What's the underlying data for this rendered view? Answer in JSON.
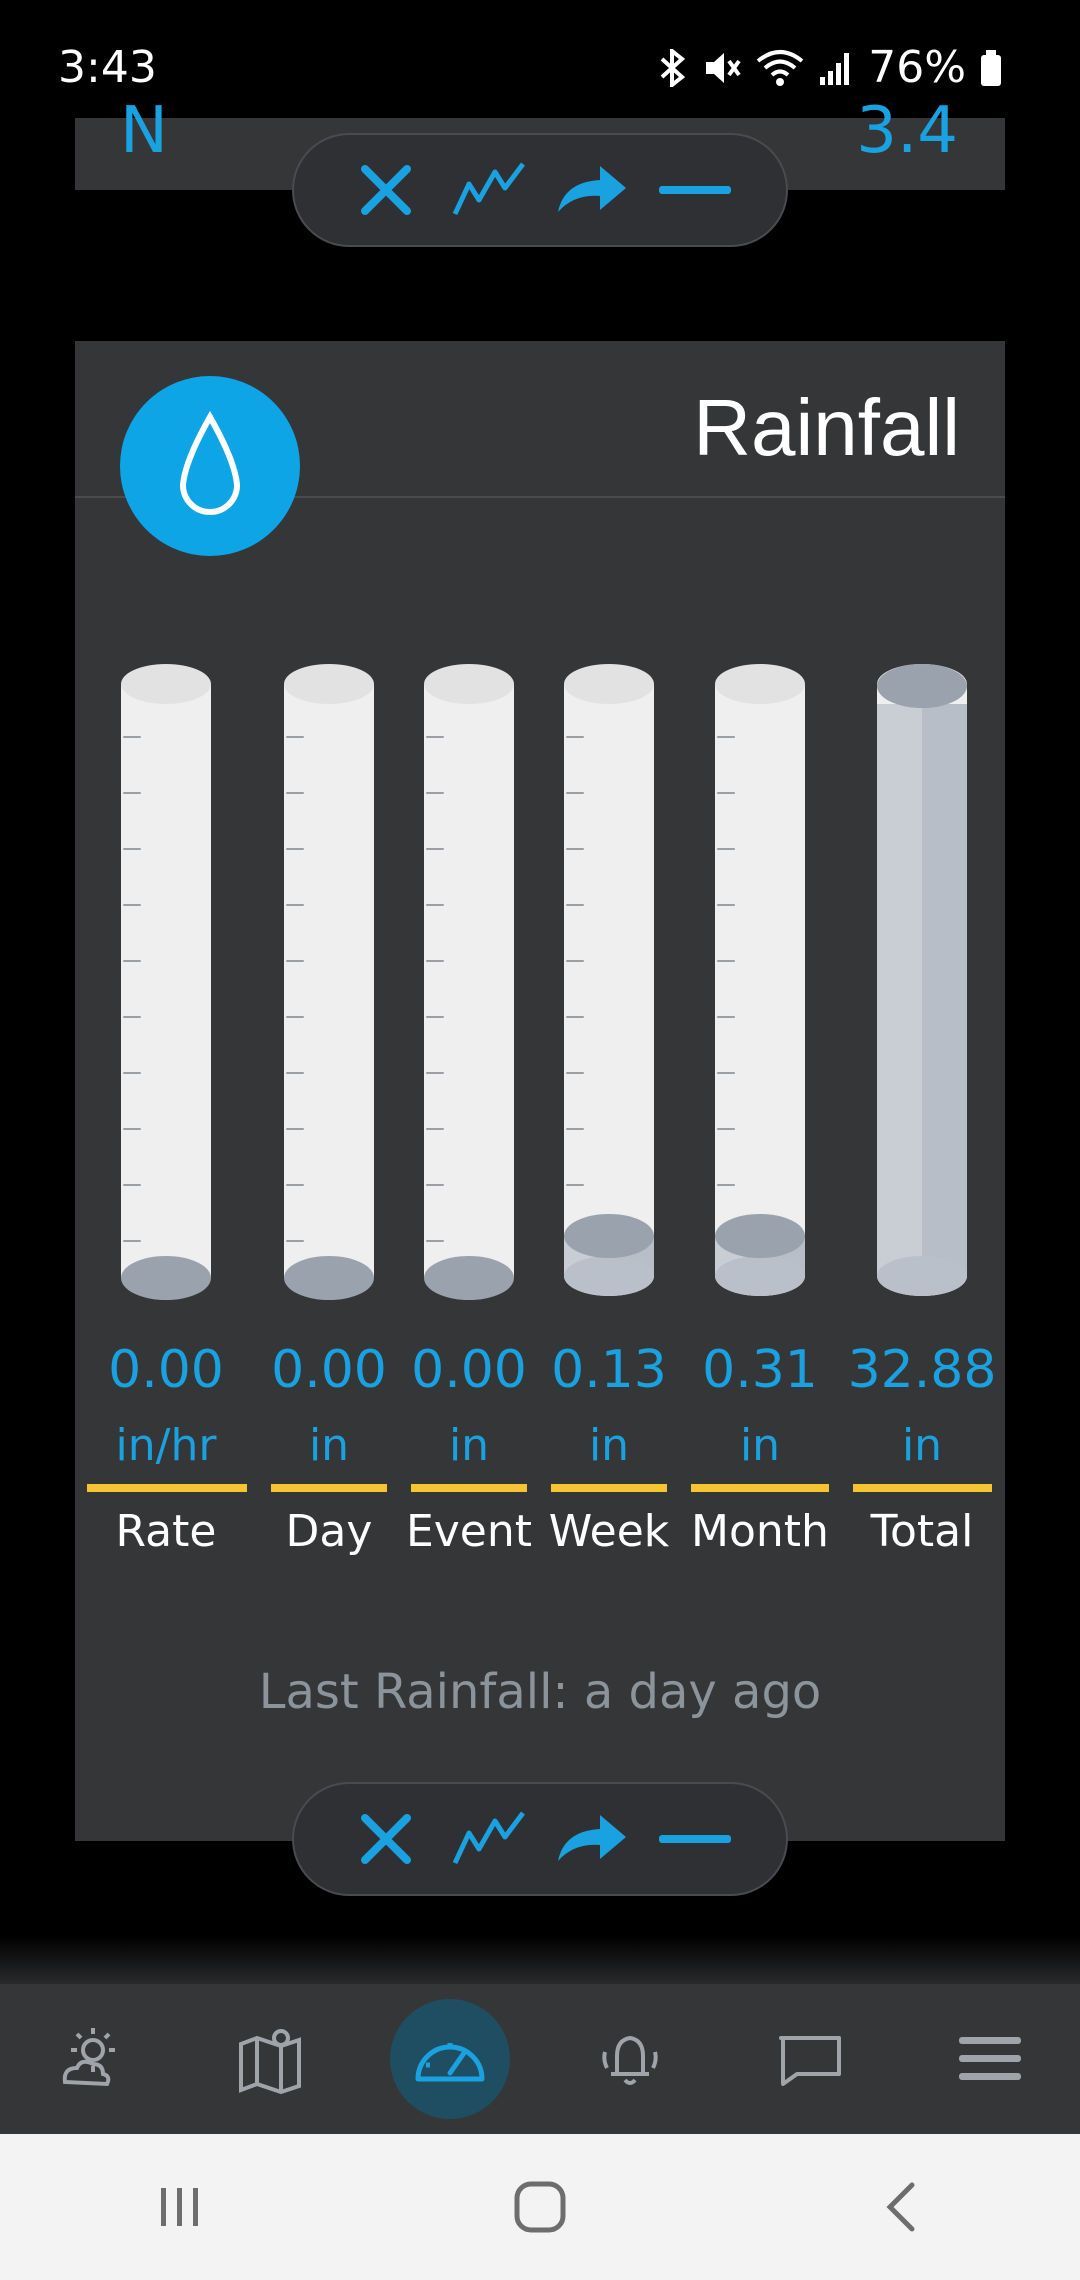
{
  "status": {
    "time": "3:43",
    "battery": "76%"
  },
  "prev_card": {
    "left_value": "N",
    "right_value": "3.4"
  },
  "toolbar": {
    "close_icon": "close-icon",
    "chart_icon": "chart-icon",
    "share_icon": "share-icon",
    "minimize_icon": "minimize-icon"
  },
  "rainfall": {
    "title": "Rainfall",
    "gauges": [
      {
        "value": "0.00",
        "unit": "in/hr",
        "label": "Rate",
        "fill_fraction": 0
      },
      {
        "value": "0.00",
        "unit": "in",
        "label": "Day",
        "fill_fraction": 0
      },
      {
        "value": "0.00",
        "unit": "in",
        "label": "Event",
        "fill_fraction": 0
      },
      {
        "value": "0.13",
        "unit": "in",
        "label": "Week",
        "fill_fraction": 0.07
      },
      {
        "value": "0.31",
        "unit": "in",
        "label": "Month",
        "fill_fraction": 0.07
      },
      {
        "value": "32.88",
        "unit": "in",
        "label": "Total",
        "fill_fraction": 1
      }
    ],
    "last_rainfall": "Last Rainfall: a day ago"
  },
  "bottom_nav": [
    "weather-icon",
    "map-icon",
    "dashboard-icon",
    "alerts-icon",
    "messages-icon",
    "menu-icon"
  ],
  "system_nav": [
    "recent-apps-icon",
    "home-icon",
    "back-icon"
  ],
  "colors": {
    "accent": "#19a1e0",
    "card": "#353638",
    "bar": "#f4c531"
  }
}
